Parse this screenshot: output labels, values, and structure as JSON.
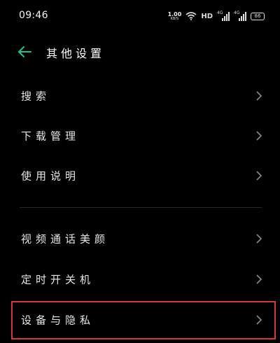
{
  "status_bar": {
    "time": "09:46",
    "net_speed_value": "1.00",
    "net_speed_unit": "KB/S",
    "hd_label": "HD",
    "signal1_label": "4G",
    "signal2_label": "4G",
    "battery": "86",
    "icons": [
      "wifi-icon",
      "signal-icon",
      "signal-icon",
      "battery-icon"
    ]
  },
  "header": {
    "title": "其他设置",
    "back_icon": "back-arrow-icon",
    "accent_color": "#1fc08a"
  },
  "menu": {
    "items": [
      {
        "label": "搜索",
        "icon": "chevron-right-icon"
      },
      {
        "label": "下载管理",
        "icon": "chevron-right-icon"
      },
      {
        "label": "使用说明",
        "icon": "chevron-right-icon"
      },
      {
        "label": "视频通话美颜",
        "icon": "chevron-right-icon"
      },
      {
        "label": "定时开关机",
        "icon": "chevron-right-icon"
      },
      {
        "label": "设备与隐私",
        "icon": "chevron-right-icon"
      }
    ]
  },
  "highlight_color": "#d23a3a"
}
